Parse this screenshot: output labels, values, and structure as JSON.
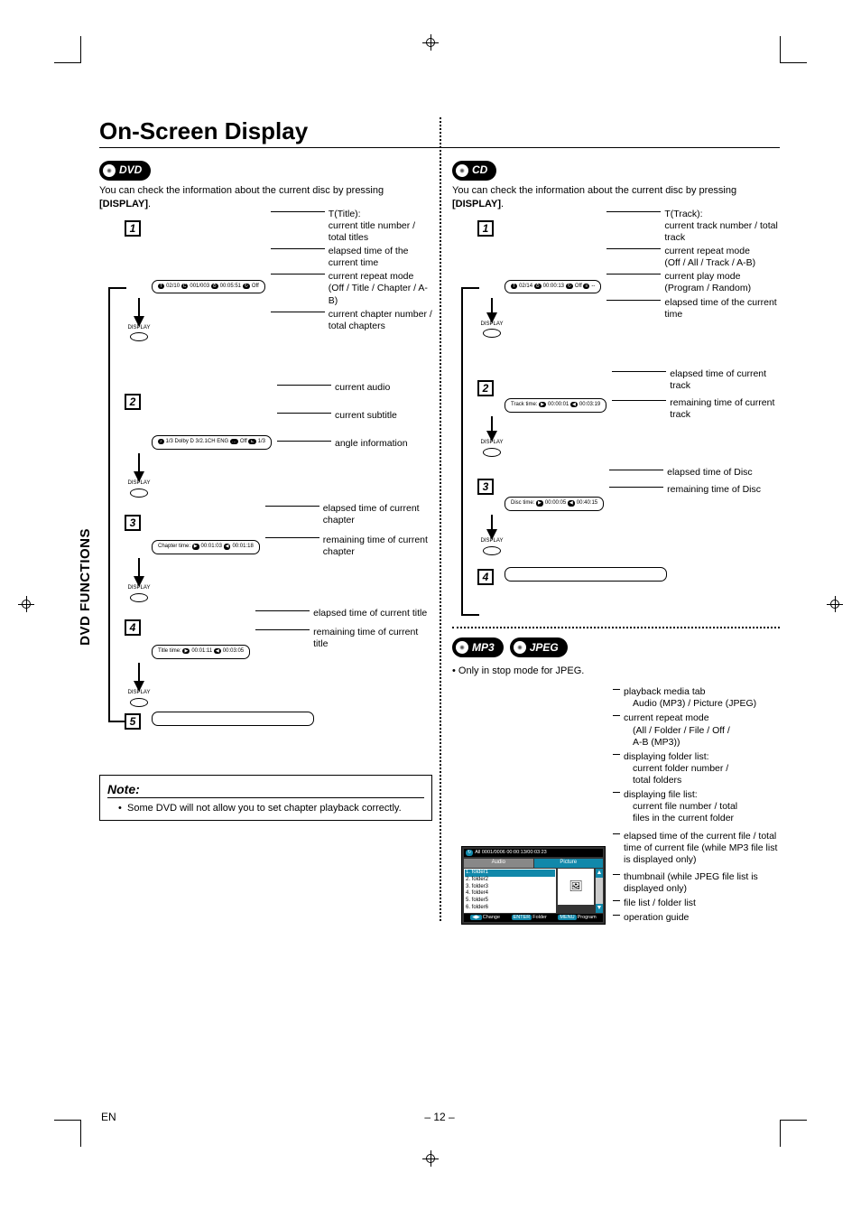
{
  "page": {
    "title": "On-Screen Display",
    "side_tab": "DVD FUNCTIONS",
    "footer_lang": "EN",
    "footer_page": "– 12 –"
  },
  "dvd": {
    "badge": "DVD",
    "intro_pre": "You can check the information about the current disc by pressing ",
    "intro_bold": "[DISPLAY]",
    "intro_post": ".",
    "display_label": "DISPLAY",
    "steps": {
      "1": {
        "osd": {
          "t": "02/10",
          "c": "001/003",
          "time": "00:05:51",
          "rep": "Off"
        },
        "annots": [
          "T(Title):\ncurrent title number / total titles",
          "elapsed time of the current time",
          "current repeat mode\n(Off / Title / Chapter / A-B)",
          "current chapter number / total chapters"
        ]
      },
      "2": {
        "osd": {
          "audio": "1/3 Dolby D 3/2.1CH ENG",
          "sub": "Off",
          "angle": "1/3"
        },
        "annots": [
          "current audio",
          "current subtitle",
          "angle information"
        ]
      },
      "3": {
        "osd": {
          "label": "Chapter time:",
          "a": "00:01:03",
          "b": "00:01:18"
        },
        "annots": [
          "elapsed time of current chapter",
          "remaining time of current chapter"
        ]
      },
      "4": {
        "osd": {
          "label": "Title time:",
          "a": "00:01:11",
          "b": "00:03:05"
        },
        "annots": [
          "elapsed time of current title",
          "remaining time of current title"
        ]
      }
    },
    "note_header": "Note:",
    "note_item": "Some DVD will not allow you to set chapter playback correctly."
  },
  "cd": {
    "badge": "CD",
    "intro_pre": "You can check the information about the current disc by pressing ",
    "intro_bold": "[DISPLAY]",
    "intro_post": ".",
    "display_label": "DISPLAY",
    "steps": {
      "1": {
        "osd": {
          "t": "02/14",
          "time": "00:00:13",
          "rep": "Off",
          "mode": "--"
        },
        "annots": [
          "T(Track):\ncurrent track number / total track",
          "current repeat mode\n(Off / All / Track / A-B)",
          "current play mode\n(Program / Random)",
          "elapsed time of the current time"
        ]
      },
      "2": {
        "osd": {
          "label": "Track time:",
          "a": "00:00:01",
          "b": "00:03:19"
        },
        "annots": [
          "elapsed time of current track",
          "remaining time of current track"
        ]
      },
      "3": {
        "osd": {
          "label": "Disc time:",
          "a": "00:00:05",
          "b": "00:40:15"
        },
        "annots": [
          "elapsed time of Disc",
          "remaining time of Disc"
        ]
      }
    }
  },
  "mp3": {
    "badge1": "MP3",
    "badge2": "JPEG",
    "note": "Only in stop mode for JPEG.",
    "browser": {
      "top_info": "All   0001/0006   00:00:13/00:03:23",
      "tab_audio": "Audio",
      "tab_picture": "Picture",
      "folders": [
        "1. folder1",
        "2. folder2",
        "3. folder3",
        "4. folder4",
        "5. folder5",
        "6. folder6"
      ],
      "op_change": "Change",
      "op_folder": "Folder",
      "op_program": "Program"
    },
    "annots": [
      {
        "main": "playback media tab",
        "sub": "Audio (MP3) / Picture (JPEG)"
      },
      {
        "main": "current repeat mode",
        "sub": "(All / Folder / File / Off /\n A-B (MP3))"
      },
      {
        "main": "displaying folder list:",
        "sub": "current folder number /\ntotal folders"
      },
      {
        "main": "displaying file list:",
        "sub": "current file number / total\nfiles in the current folder"
      },
      {
        "main": "elapsed time of the current file / total time of current file (while MP3 file list is displayed only)"
      },
      {
        "main": "thumbnail (while JPEG file list is displayed only)"
      },
      {
        "main": "file list / folder list"
      },
      {
        "main": "operation guide"
      }
    ]
  }
}
